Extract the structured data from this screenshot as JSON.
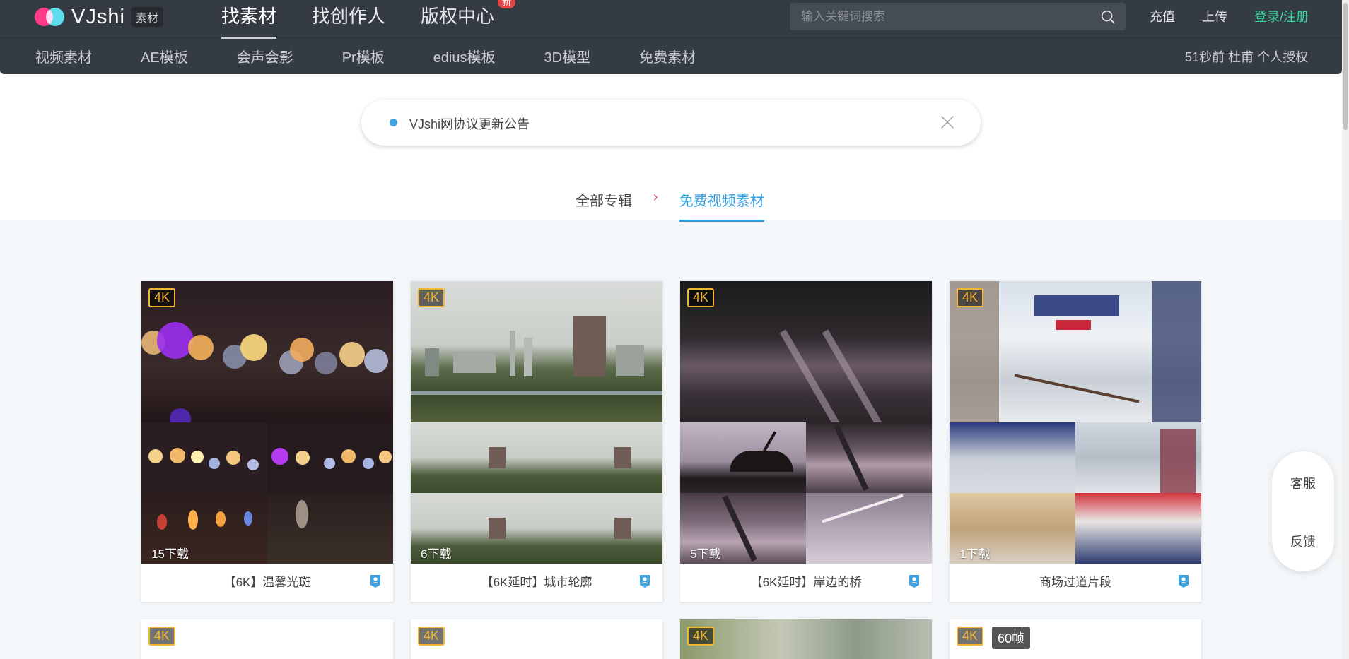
{
  "header": {
    "logo_text": "VJshi",
    "logo_tag": "素材",
    "nav": [
      {
        "label": "找素材",
        "active": true
      },
      {
        "label": "找创作人",
        "active": false
      },
      {
        "label": "版权中心",
        "active": false,
        "badge": "新"
      }
    ],
    "search_placeholder": "输入关键词搜索",
    "links": {
      "recharge": "充值",
      "upload": "上传",
      "login": "登录/注册"
    },
    "subnav": [
      "视频素材",
      "AE模板",
      "会声会影",
      "Pr模板",
      "edius模板",
      "3D模型",
      "免费素材"
    ],
    "activity": "51秒前 杜甫 个人授权"
  },
  "notice": {
    "text": "VJshi网协议更新公告"
  },
  "breadcrumb": {
    "root": "全部专辑",
    "separator": "›",
    "current": "免费视频素材"
  },
  "cards": [
    {
      "badge": "4K",
      "downloads": "15下载",
      "title": "【6K】温馨光斑"
    },
    {
      "badge": "4K",
      "downloads": "6下载",
      "title": "【6K延时】城市轮廓"
    },
    {
      "badge": "4K",
      "downloads": "5下载",
      "title": "【6K延时】岸边的桥"
    },
    {
      "badge": "4K",
      "downloads": "1下载",
      "title": "商场过道片段"
    }
  ],
  "cards_row2": [
    {
      "badge": "4K"
    },
    {
      "badge": "4K"
    },
    {
      "badge": "4K"
    },
    {
      "badge": "4K",
      "fps": "60帧"
    }
  ],
  "side": {
    "service": "客服",
    "feedback": "反馈"
  },
  "colors": {
    "header_bg": "#353b42",
    "accent_blue": "#2f9fe0",
    "login_green": "#3ad29f",
    "badge_gold": "#f2b632"
  }
}
